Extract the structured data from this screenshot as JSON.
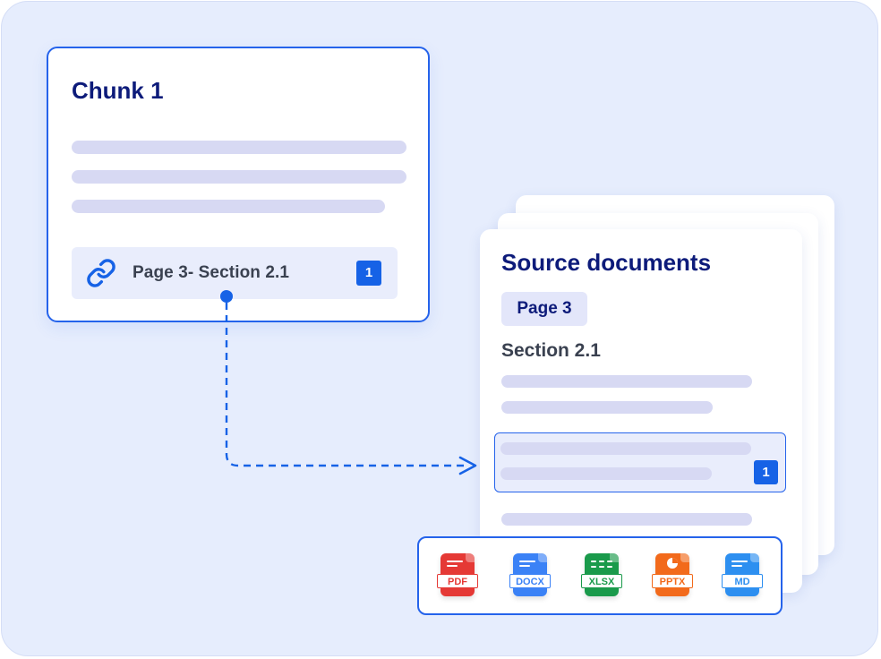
{
  "chunk_card": {
    "title": "Chunk 1",
    "reference": {
      "icon": "link-icon",
      "text": "Page 3- Section 2.1",
      "badge": "1"
    }
  },
  "source_documents": {
    "title": "Source documents",
    "page_label": "Page 3",
    "section_label": "Section 2.1",
    "highlight_badge": "1"
  },
  "file_types": [
    {
      "label": "PDF",
      "icon": "pdf-file-icon",
      "color": "#e53935"
    },
    {
      "label": "DOCX",
      "icon": "docx-file-icon",
      "color": "#3b82f6"
    },
    {
      "label": "XLSX",
      "icon": "xlsx-file-icon",
      "color": "#1a9a4b"
    },
    {
      "label": "PPTX",
      "icon": "pptx-file-icon",
      "color": "#f26a1b"
    },
    {
      "label": "MD",
      "icon": "md-file-icon",
      "color": "#2d8ff0"
    }
  ],
  "colors": {
    "accent": "#2563eb",
    "title": "#0d1b7a",
    "background": "#e6edfd",
    "placeholder_bar": "#d7d9f3"
  }
}
